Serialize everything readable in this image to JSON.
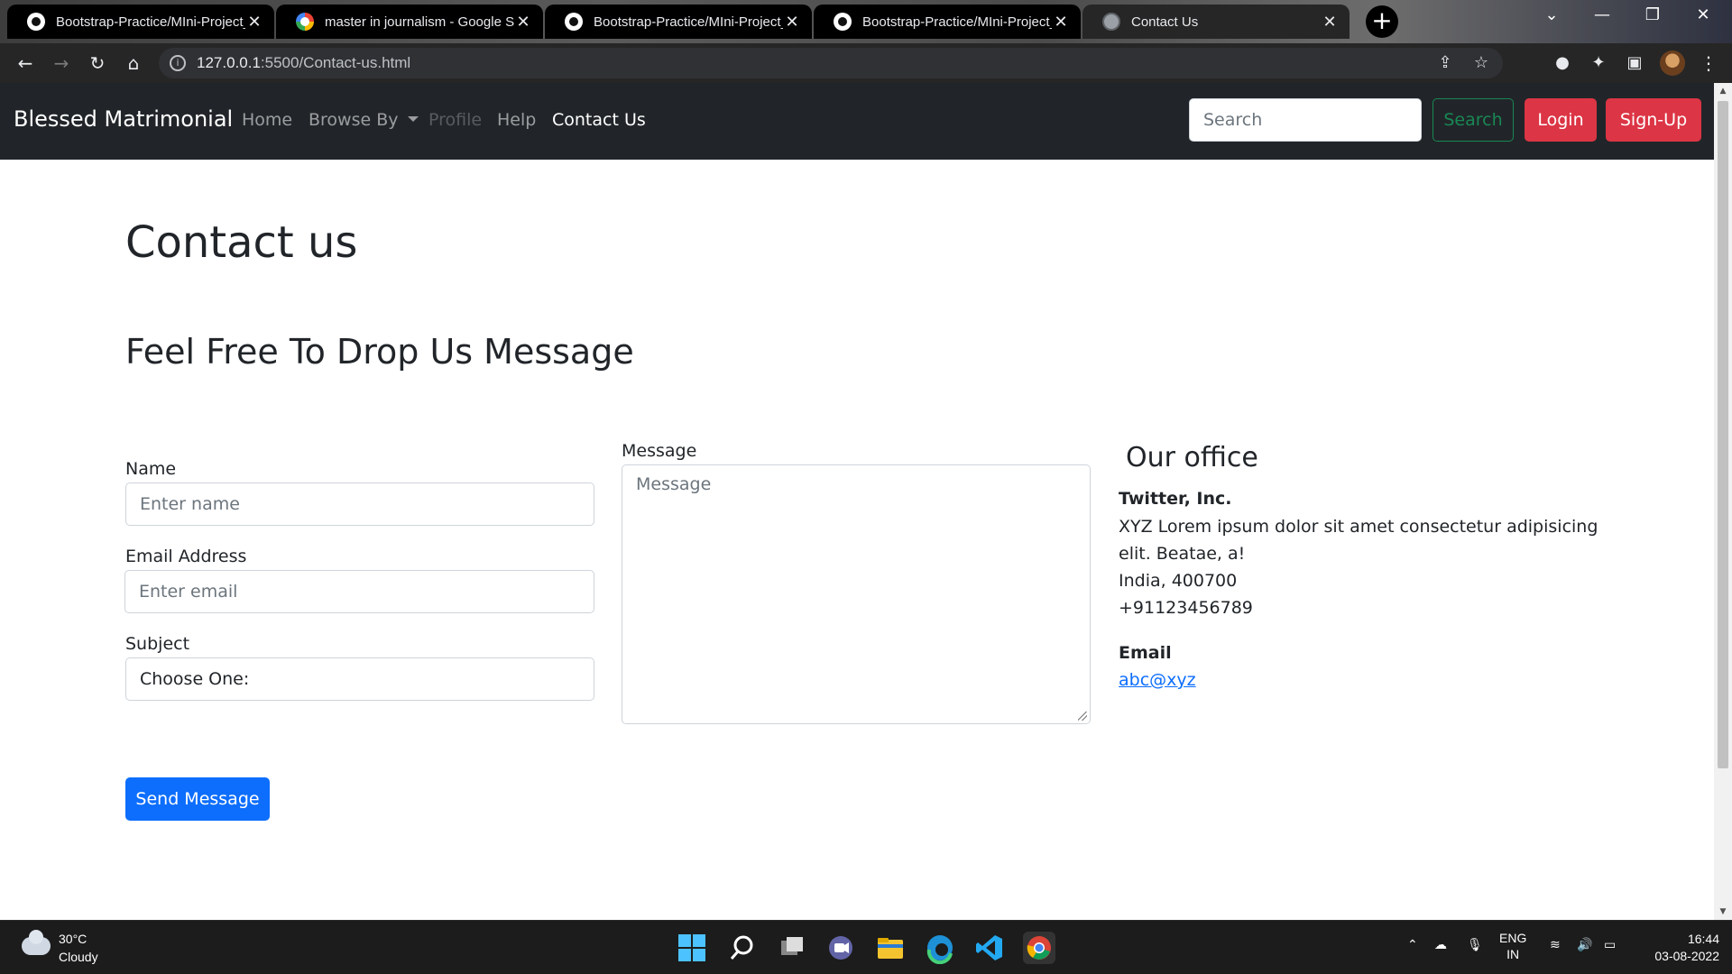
{
  "browser": {
    "tabs": [
      {
        "title": "Bootstrap-Practice/MIni-Project_",
        "favicon": "github-icon"
      },
      {
        "title": "master in journalism - Google Se",
        "favicon": "google-icon"
      },
      {
        "title": "Bootstrap-Practice/MIni-Project_",
        "favicon": "github-icon"
      },
      {
        "title": "Bootstrap-Practice/MIni-Project_",
        "favicon": "github-icon"
      },
      {
        "title": "Contact Us",
        "favicon": "globe-icon"
      }
    ],
    "close_glyph": "✕",
    "new_tab_glyph": "+",
    "url_host": "127.0.0.1",
    "url_path": ":5500/Contact-us.html"
  },
  "navbar": {
    "brand": "Blessed Matrimonial",
    "links": [
      "Home",
      "Browse By",
      "Profile",
      "Help",
      "Contact Us"
    ],
    "search_placeholder": "Search",
    "search_button": "Search",
    "login": "Login",
    "signup": "Sign-Up"
  },
  "page": {
    "title": "Contact us",
    "subtitle": "Feel Free To Drop Us Message"
  },
  "form": {
    "name_label": "Name",
    "name_placeholder": "Enter name",
    "email_label": "Email Address",
    "email_placeholder": "Enter email",
    "subject_label": "Subject",
    "subject_value": "Choose One:",
    "message_label": "Message",
    "message_placeholder": "Message",
    "send_button": "Send Message"
  },
  "office": {
    "heading": "Our office",
    "company": "Twitter, Inc.",
    "address_line1": "XYZ Lorem ipsum dolor sit amet consectetur adipisicing",
    "address_line2": "elit. Beatae, a!",
    "address_line3": "India, 400700",
    "phone": "+91123456789",
    "email_label": "Email",
    "email": "abc@xyz"
  },
  "taskbar": {
    "temperature": "30°C",
    "condition": "Cloudy",
    "language_line1": "ENG",
    "language_line2": "IN",
    "time": "16:44",
    "date": "03-08-2022"
  },
  "colors": {
    "navbar_bg": "#212529",
    "danger": "#dc3545",
    "primary": "#0d6efd",
    "success": "#198754"
  }
}
